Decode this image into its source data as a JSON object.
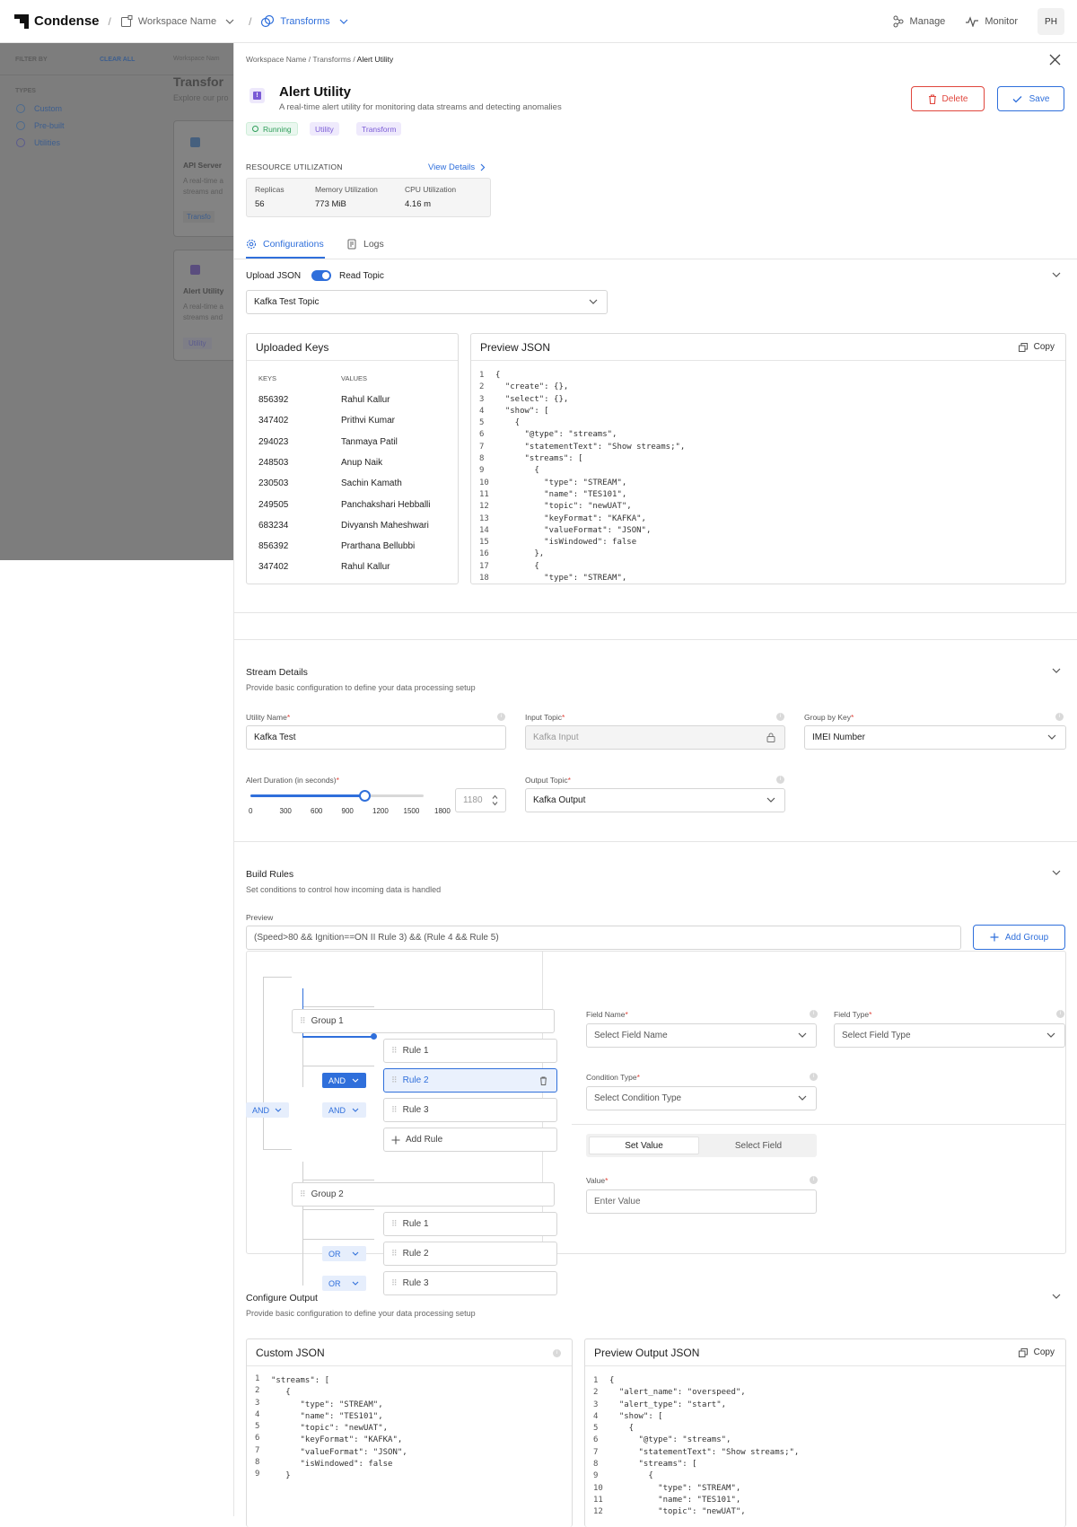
{
  "nav": {
    "brand": "Condense",
    "workspace": "Workspace Name",
    "section": "Transforms",
    "manage": "Manage",
    "monitor": "Monitor",
    "avatar": "PH"
  },
  "bg": {
    "filter_by": "FILTER BY",
    "clear_all": "CLEAR ALL",
    "types": "TYPES",
    "type_items": [
      "Custom",
      "Pre-built",
      "Utilities"
    ],
    "breadcrumb": "Workspace Nam",
    "title": "Transfor",
    "subtitle": "Explore our pro",
    "card1_title": "API Server",
    "card1_desc1": "A real-time a",
    "card1_desc2": "streams and",
    "card1_chip": "Transfo",
    "card2_title": "Alert Utility",
    "card2_desc1": "A real-time a",
    "card2_desc2": "streams and",
    "card2_chip": "Utility"
  },
  "panel": {
    "breadcrumb": [
      "Workspace Name",
      "Transforms",
      "Alert Utility"
    ],
    "title": "Alert Utility",
    "subtitle": "A real-time alert utility for monitoring data streams and detecting anomalies",
    "tags": [
      "Running",
      "Utility",
      "Transform"
    ],
    "delete_label": "Delete",
    "save_label": "Save"
  },
  "resource": {
    "heading": "RESOURCE UTILIZATION",
    "view_details": "View Details",
    "metrics": [
      {
        "label": "Replicas",
        "value": "56"
      },
      {
        "label": "Memory Utilization",
        "value": "773 MiB"
      },
      {
        "label": "CPU Utilization",
        "value": "4.16 m"
      }
    ]
  },
  "tabs": [
    "Configurations",
    "Logs"
  ],
  "upload": {
    "upload_json": "Upload JSON",
    "read_topic": "Read Topic",
    "topic_value": "Kafka Test Topic"
  },
  "uploaded_keys": {
    "title": "Uploaded Keys",
    "col_keys": "KEYS",
    "col_values": "VALUES",
    "rows": [
      {
        "key": "856392",
        "value": "Rahul Kallur"
      },
      {
        "key": "347402",
        "value": "Prithvi Kumar"
      },
      {
        "key": "294023",
        "value": "Tanmaya Patil"
      },
      {
        "key": "248503",
        "value": "Anup Naik"
      },
      {
        "key": "230503",
        "value": "Sachin Kamath"
      },
      {
        "key": "249505",
        "value": "Panchakshari Hebballi"
      },
      {
        "key": "683234",
        "value": "Divyansh Maheshwari"
      },
      {
        "key": "856392",
        "value": "Prarthana Bellubbi"
      },
      {
        "key": "347402",
        "value": "Rahul Kallur"
      }
    ]
  },
  "preview_json": {
    "title": "Preview JSON",
    "copy": "Copy",
    "line_numbers": "1\n2\n3\n4\n5\n6\n7\n8\n9\n10\n11\n12\n13\n14\n15\n16\n17\n18",
    "code": "{\n  \"create\": {},\n  \"select\": {},\n  \"show\": [\n    {\n      \"@type\": \"streams\",\n      \"statementText\": \"Show streams;\",\n      \"streams\": [\n        {\n          \"type\": \"STREAM\",\n          \"name\": \"TES101\",\n          \"topic\": \"newUAT\",\n          \"keyFormat\": \"KAFKA\",\n          \"valueFormat\": \"JSON\",\n          \"isWindowed\": false\n        },\n        {\n          \"type\": \"STREAM\","
  },
  "stream": {
    "title": "Stream Details",
    "subtitle": "Provide basic configuration to define your data processing setup",
    "utility_name_label": "Utility Name",
    "utility_name_value": "Kafka Test",
    "input_topic_label": "Input Topic",
    "input_topic_value": "Kafka Input",
    "group_key_label": "Group by Key",
    "group_key_value": "IMEI Number",
    "alert_duration_label": "Alert Duration (in seconds)",
    "slider_ticks": [
      "0",
      "300",
      "600",
      "900",
      "1200",
      "1500",
      "1800"
    ],
    "slider_value": 1180,
    "slider_max": 1800,
    "slider_display": "1180",
    "output_topic_label": "Output Topic",
    "output_topic_value": "Kafka Output"
  },
  "rules": {
    "title": "Build Rules",
    "subtitle": "Set conditions to control how incoming data is handled",
    "preview_label": "Preview",
    "preview_value": "(Speed>80 && Ignition==ON II Rule 3) && (Rule 4 && Rule 5)",
    "add_group": "Add Group",
    "root_op": "AND",
    "group1": "Group 1",
    "group2": "Group 2",
    "g1_rules": [
      "Rule 1",
      "Rule 2",
      "Rule 3"
    ],
    "g1_ops": [
      "AND",
      "AND"
    ],
    "add_rule": "Add Rule",
    "g2_rules": [
      "Rule 1",
      "Rule 2",
      "Rule 3"
    ],
    "g2_ops": [
      "OR",
      "OR"
    ],
    "field_name_label": "Field Name",
    "field_name_ph": "Select Field Name",
    "field_type_label": "Field Type",
    "field_type_ph": "Select Field Type",
    "condition_type_label": "Condition Type",
    "condition_type_ph": "Select Condition Type",
    "set_value": "Set Value",
    "select_field": "Select Field",
    "value_label": "Value",
    "value_ph": "Enter Value"
  },
  "output": {
    "title": "Configure Output",
    "subtitle": "Provide basic configuration to define your data processing setup",
    "custom_title": "Custom JSON",
    "custom_lines": "1\n2\n3\n4\n5\n6\n7\n8\n9",
    "custom_code": "\"streams\": [\n   {\n      \"type\": \"STREAM\",\n      \"name\": \"TES101\",\n      \"topic\": \"newUAT\",\n      \"keyFormat\": \"KAFKA\",\n      \"valueFormat\": \"JSON\",\n      \"isWindowed\": false\n   }",
    "preview_title": "Preview Output JSON",
    "copy": "Copy",
    "preview_lines": "1\n2\n3\n4\n5\n6\n7\n8\n9\n10\n11\n12",
    "preview_code": "{\n  \"alert_name\": \"overspeed\",\n  \"alert_type\": \"start\",\n  \"show\": [\n    {\n      \"@type\": \"streams\",\n      \"statementText\": \"Show streams;\",\n      \"streams\": [\n        {\n          \"type\": \"STREAM\",\n          \"name\": \"TES101\",\n          \"topic\": \"newUAT\","
  },
  "colors": {
    "accent": "#2f6fdb",
    "danger": "#e0463d",
    "running": "#2f9e5a",
    "purple": "#7b5cd6"
  }
}
